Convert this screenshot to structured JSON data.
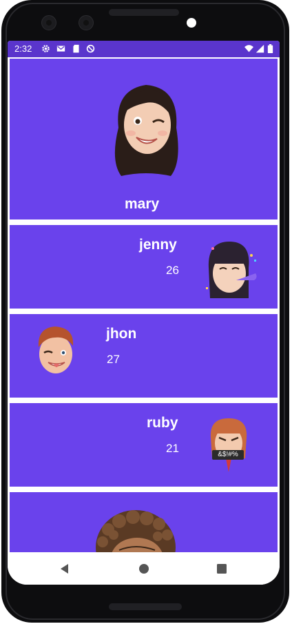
{
  "status_bar": {
    "time": "2:32",
    "left_icons": [
      "gear-icon",
      "gmail-icon",
      "sd-card-icon",
      "sync-disabled-icon"
    ],
    "right_icons": [
      "wifi-icon",
      "cellular-signal-icon",
      "battery-icon"
    ],
    "color": "#5a35cc"
  },
  "colors": {
    "card": "#6a42ec",
    "text": "#ffffff"
  },
  "users": [
    {
      "name": "mary",
      "avatar": "memoji-woman-winking-avatar"
    },
    {
      "name": "jenny",
      "age": "26",
      "avatar": "memoji-woman-party-horn-avatar"
    },
    {
      "name": "jhon",
      "age": "27",
      "avatar": "memoji-man-winking-avatar"
    },
    {
      "name": "ruby",
      "age": "21",
      "avatar": "memoji-woman-angry-censored-avatar",
      "censor_text": "&$!#%"
    },
    {
      "avatar": "memoji-curly-hair-avatar"
    }
  ],
  "nav_bar": {
    "buttons": [
      "back-triangle-icon",
      "home-circle-icon",
      "recents-square-icon"
    ]
  }
}
